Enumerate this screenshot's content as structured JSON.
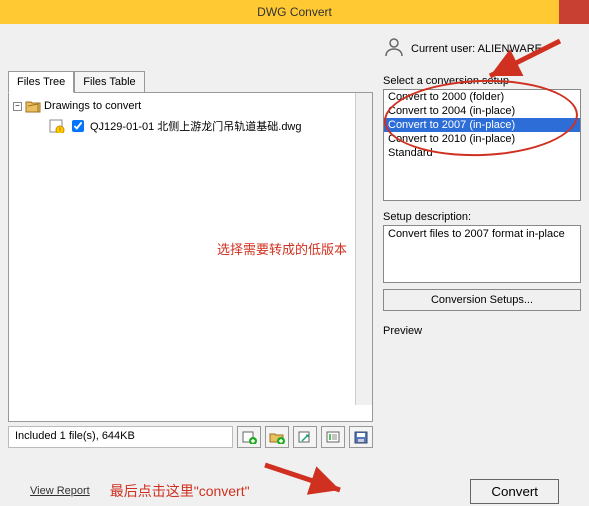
{
  "window": {
    "title": "DWG Convert"
  },
  "user": {
    "label": "Current user: ALIENWARE"
  },
  "tabs": {
    "tree": "Files Tree",
    "table": "Files Table"
  },
  "tree": {
    "root_label": "Drawings to convert",
    "file_label": "QJ129-01-01 北侧上游龙门吊轨道基础.dwg"
  },
  "annotations": {
    "top": "选择需要转成的低版本",
    "bottom": "最后点击这里\"convert\""
  },
  "status": {
    "text": "Included 1 file(s), 644KB"
  },
  "conversion": {
    "select_label": "Select a conversion setup",
    "items": [
      "Convert to 2000 (folder)",
      "Convert to 2004 (in-place)",
      "Convert to 2007 (in-place)",
      "Convert to 2010 (in-place)",
      "Standard"
    ],
    "selected_index": 2
  },
  "setup_desc": {
    "label": "Setup description:",
    "value": "Convert files to 2007 format in-place"
  },
  "buttons": {
    "conversion_setups": "Conversion Setups...",
    "preview_label": "Preview",
    "view_report": "View Report",
    "convert": "Convert"
  }
}
